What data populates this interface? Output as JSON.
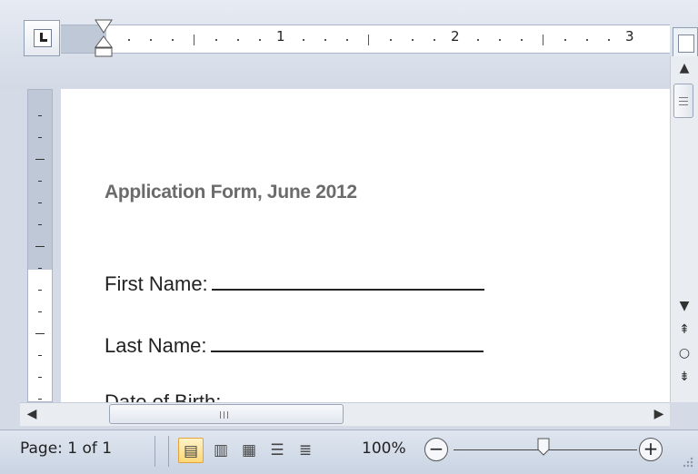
{
  "ruler": {
    "numbers": [
      "1",
      "2",
      "3"
    ]
  },
  "document": {
    "title": "Application Form, June 2012",
    "fields": [
      {
        "label": "First Name:"
      },
      {
        "label": "Last Name:"
      },
      {
        "label": "Date of Birth:"
      }
    ]
  },
  "status_bar": {
    "page_indicator": "Page: 1 of 1",
    "zoom_level": "100%",
    "zoom_percent": 100,
    "view_buttons": [
      "print-layout",
      "full-screen-reading",
      "web-layout",
      "outline",
      "draft"
    ]
  },
  "colors": {
    "title_text": "#6b6b6b",
    "active_view": "#ffd777",
    "chrome": "#d4dbe6"
  }
}
